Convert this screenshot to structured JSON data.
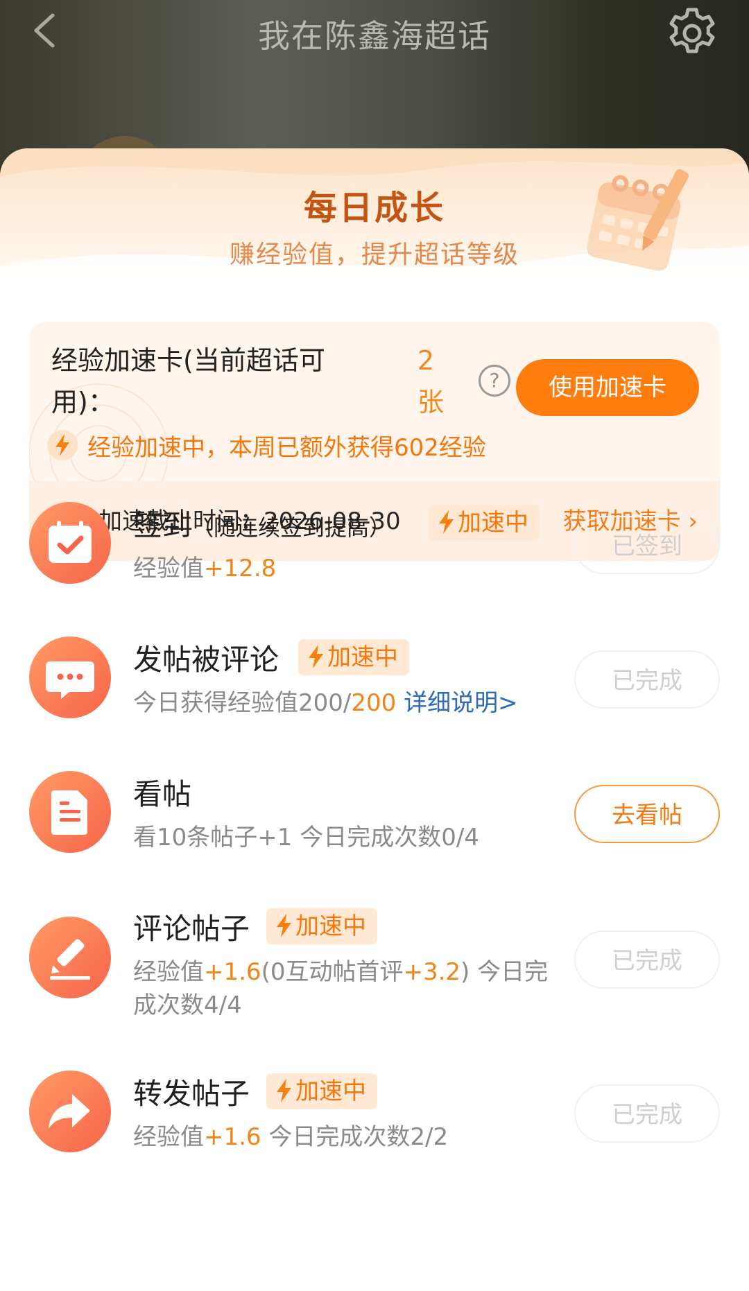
{
  "header": {
    "title": "我在陈鑫海超话"
  },
  "sheet": {
    "title": "每日成长",
    "subtitle": "赚经验值，提升超话等级"
  },
  "boost_card": {
    "name": "经验加速卡(当前超话可用)：",
    "count": "2张",
    "help_glyph": "?",
    "use_button": "使用加速卡",
    "status": "经验加速中，本周已额外获得602经验",
    "deadline_label": "经验加速截止时间：",
    "deadline_date": "2026-08-30",
    "get_card_link": "获取加速卡",
    "get_card_arrow": "›"
  },
  "tasks": [
    {
      "icon": "calendar-check-icon",
      "name": "签到",
      "name_note": "（随连续签到提高）",
      "badge": "加速中",
      "desc_label": "经验值",
      "desc_value": "+12.8",
      "button": "已签到",
      "button_state": "done"
    },
    {
      "icon": "chat-bubble-icon",
      "name": "发帖被评论",
      "badge": "加速中",
      "desc_label": "今日获得经验值200/",
      "desc_value": "200",
      "desc_link": "详细说明>",
      "button": "已完成",
      "button_state": "done"
    },
    {
      "icon": "document-icon",
      "name": "看帖",
      "desc_label": "看10条帖子+1 今日完成次数0/4",
      "button": "去看帖",
      "button_state": "active"
    },
    {
      "icon": "pencil-icon",
      "name": "评论帖子",
      "badge": "加速中",
      "desc_label": "经验值",
      "desc_value": "+1.6",
      "desc_mid": "(0互动帖首评",
      "desc_value2": "+3.2",
      "desc_tail": ") 今日完成次数4/4",
      "button": "已完成",
      "button_state": "done"
    },
    {
      "icon": "share-arrow-icon",
      "name": "转发帖子",
      "badge": "加速中",
      "desc_label": "经验值",
      "desc_value": "+1.6",
      "desc_tail": " 今日完成次数2/2",
      "button": "已完成",
      "button_state": "done"
    }
  ],
  "colors": {
    "accent": "#ff7d0f",
    "sheet_title": "#c35412",
    "link_blue": "#2d6bb8"
  }
}
